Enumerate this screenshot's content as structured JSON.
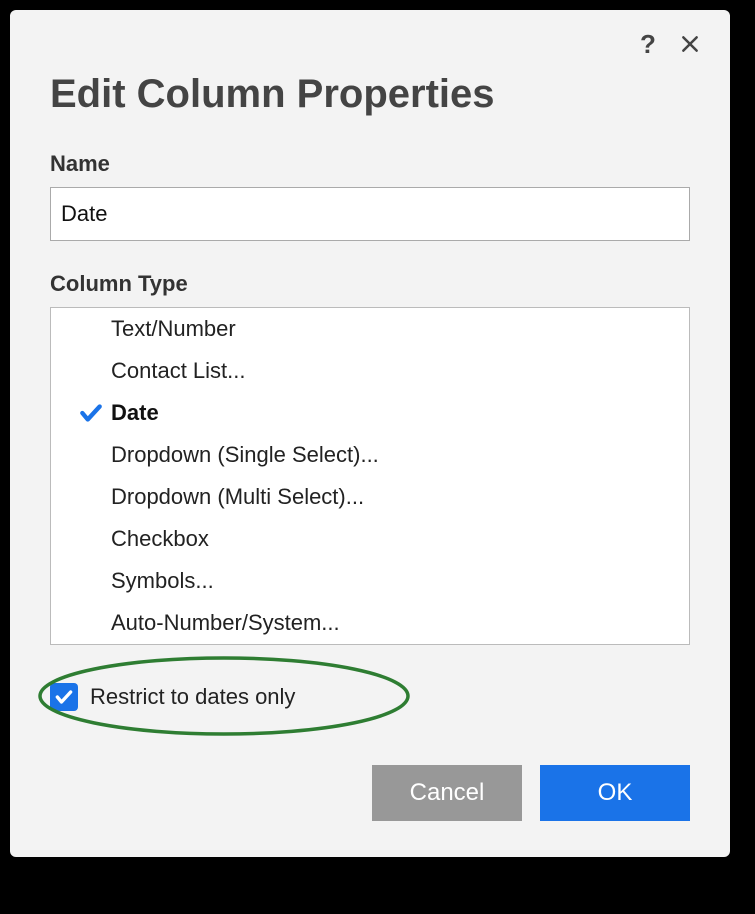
{
  "dialog": {
    "title": "Edit Column Properties",
    "help_tooltip": "?",
    "name_label": "Name",
    "name_value": "Date",
    "column_type_label": "Column Type",
    "types": [
      {
        "label": "Text/Number",
        "selected": false
      },
      {
        "label": "Contact List...",
        "selected": false
      },
      {
        "label": "Date",
        "selected": true
      },
      {
        "label": "Dropdown (Single Select)...",
        "selected": false
      },
      {
        "label": "Dropdown (Multi Select)...",
        "selected": false
      },
      {
        "label": "Checkbox",
        "selected": false
      },
      {
        "label": "Symbols...",
        "selected": false
      },
      {
        "label": "Auto-Number/System...",
        "selected": false
      }
    ],
    "restrict_label": "Restrict to dates only",
    "restrict_checked": true,
    "cancel_label": "Cancel",
    "ok_label": "OK"
  },
  "colors": {
    "accent": "#1a73e8",
    "highlight_ring": "#2e7d32"
  }
}
